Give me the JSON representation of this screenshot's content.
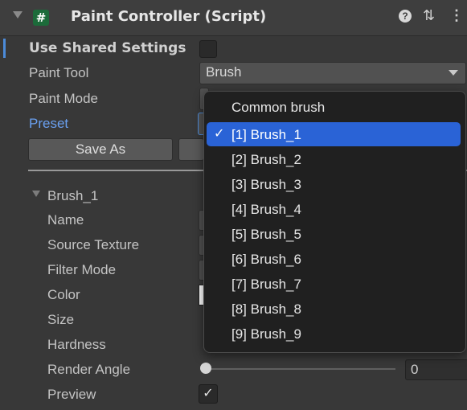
{
  "header": {
    "title": "Paint Controller (Script)",
    "script_icon": "#"
  },
  "labels": {
    "use_shared": "Use Shared Settings",
    "paint_tool": "Paint Tool",
    "paint_mode": "Paint Mode",
    "preset": "Preset",
    "brush_foldout": "Brush_1",
    "name": "Name",
    "source_texture": "Source Texture",
    "filter_mode": "Filter Mode",
    "color": "Color",
    "size": "Size",
    "hardness": "Hardness",
    "render_angle": "Render Angle",
    "preview": "Preview"
  },
  "paint_tool_value": "Brush",
  "save_as_label": "Save As",
  "render_angle_value": "0",
  "popup": {
    "header": "Common brush",
    "items": [
      "[1] Brush_1",
      "[2] Brush_2",
      "[3] Brush_3",
      "[4] Brush_4",
      "[5] Brush_5",
      "[6] Brush_6",
      "[7] Brush_7",
      "[8] Brush_8",
      "[9] Brush_9"
    ],
    "selected_index": 0,
    "check_glyph": "✓"
  },
  "colors": {
    "accent": "#2a63d6",
    "preset_label": "#6aa0f0",
    "selection_bar": "#4c8bd9"
  },
  "icons": {
    "help": "help-icon",
    "settings": "settings-icon",
    "menu": "more-options-icon"
  },
  "preview_checked": true
}
